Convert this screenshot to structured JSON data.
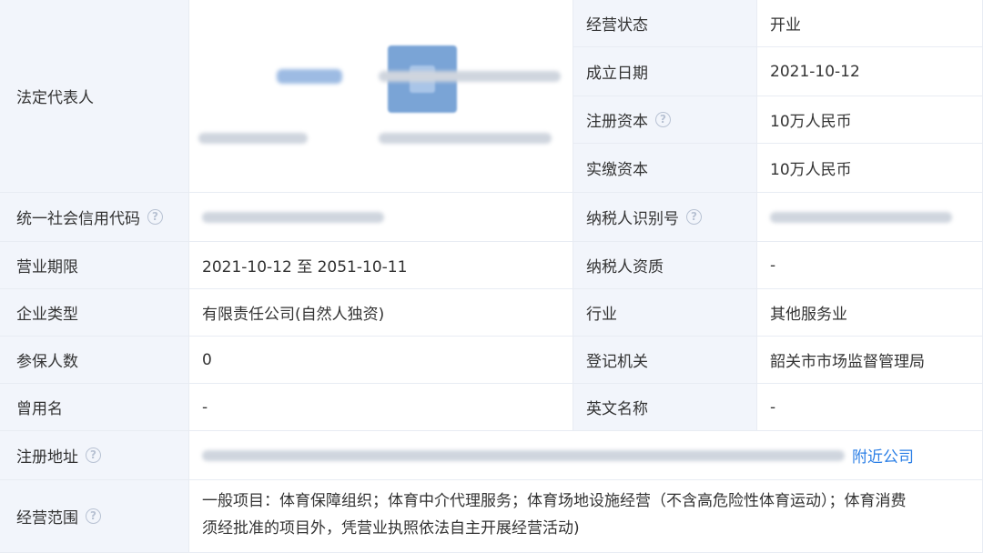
{
  "legal_rep": {
    "label": "法定代表人"
  },
  "status": {
    "label": "经营状态",
    "value": "开业"
  },
  "founded": {
    "label": "成立日期",
    "value": "2021-10-12"
  },
  "reg_capital": {
    "label": "注册资本",
    "value": "10万人民币"
  },
  "paid_capital": {
    "label": "实缴资本",
    "value": "10万人民币"
  },
  "credit_code": {
    "label": "统一社会信用代码"
  },
  "taxpayer_id": {
    "label": "纳税人识别号"
  },
  "term": {
    "label": "营业期限",
    "value": "2021-10-12 至 2051-10-11"
  },
  "taxpayer_qual": {
    "label": "纳税人资质",
    "value": "-"
  },
  "company_type": {
    "label": "企业类型",
    "value": "有限责任公司(自然人独资)"
  },
  "industry": {
    "label": "行业",
    "value": "其他服务业"
  },
  "insured": {
    "label": "参保人数",
    "value": "0"
  },
  "authority": {
    "label": "登记机关",
    "value": "韶关市市场监督管理局"
  },
  "former_name": {
    "label": "曾用名",
    "value": "-"
  },
  "english_name": {
    "label": "英文名称",
    "value": "-"
  },
  "address": {
    "label": "注册地址",
    "link": "附近公司"
  },
  "scope": {
    "label": "经营范围",
    "line1": "一般项目：体育保障组织；体育中介代理服务；体育场地设施经营（不含高危险性体育运动）；体育消费",
    "line2": "须经批准的项目外，凭营业执照依法自主开展经营活动)"
  },
  "icons": {
    "help": "question-circle-icon",
    "avatar": "avatar-icon"
  },
  "colors": {
    "label_bg": "#f2f5fb",
    "link": "#2b7fe6",
    "border": "#e8ecf3"
  }
}
